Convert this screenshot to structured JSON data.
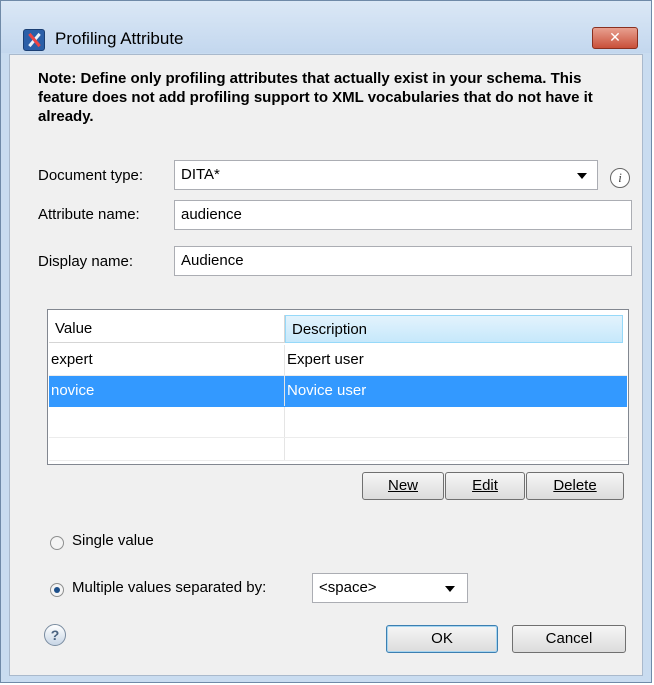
{
  "window": {
    "title": "Profiling Attribute",
    "close_symbol": "✕"
  },
  "note": "Note: Define only profiling attributes that actually exist in your schema. This feature does not add profiling support to XML vocabularies that do not have it already.",
  "form": {
    "document_type": {
      "label": "Document type:",
      "value": "DITA*"
    },
    "attribute_name": {
      "label": "Attribute name:",
      "value": "audience"
    },
    "display_name": {
      "label": "Display name:",
      "value": "Audience"
    }
  },
  "table": {
    "columns": [
      "Value",
      "Description"
    ],
    "rows": [
      {
        "value": "expert",
        "description": "Expert user"
      },
      {
        "value": "novice",
        "description": "Novice user"
      }
    ],
    "selected_row": 1
  },
  "table_buttons": {
    "new": "New",
    "edit": "Edit",
    "delete": "Delete"
  },
  "options": {
    "single_value": "Single value",
    "multiple_values": "Multiple values separated by:",
    "separator": "<space>",
    "selected": "multiple_values"
  },
  "footer": {
    "ok": "OK",
    "cancel": "Cancel",
    "help_symbol": "?"
  },
  "icons": {
    "info": "info-icon",
    "help": "help-icon",
    "app": "oxygen-x-icon"
  },
  "colors": {
    "selection": "#3399ff",
    "header_highlight": "#c6e8fb"
  }
}
